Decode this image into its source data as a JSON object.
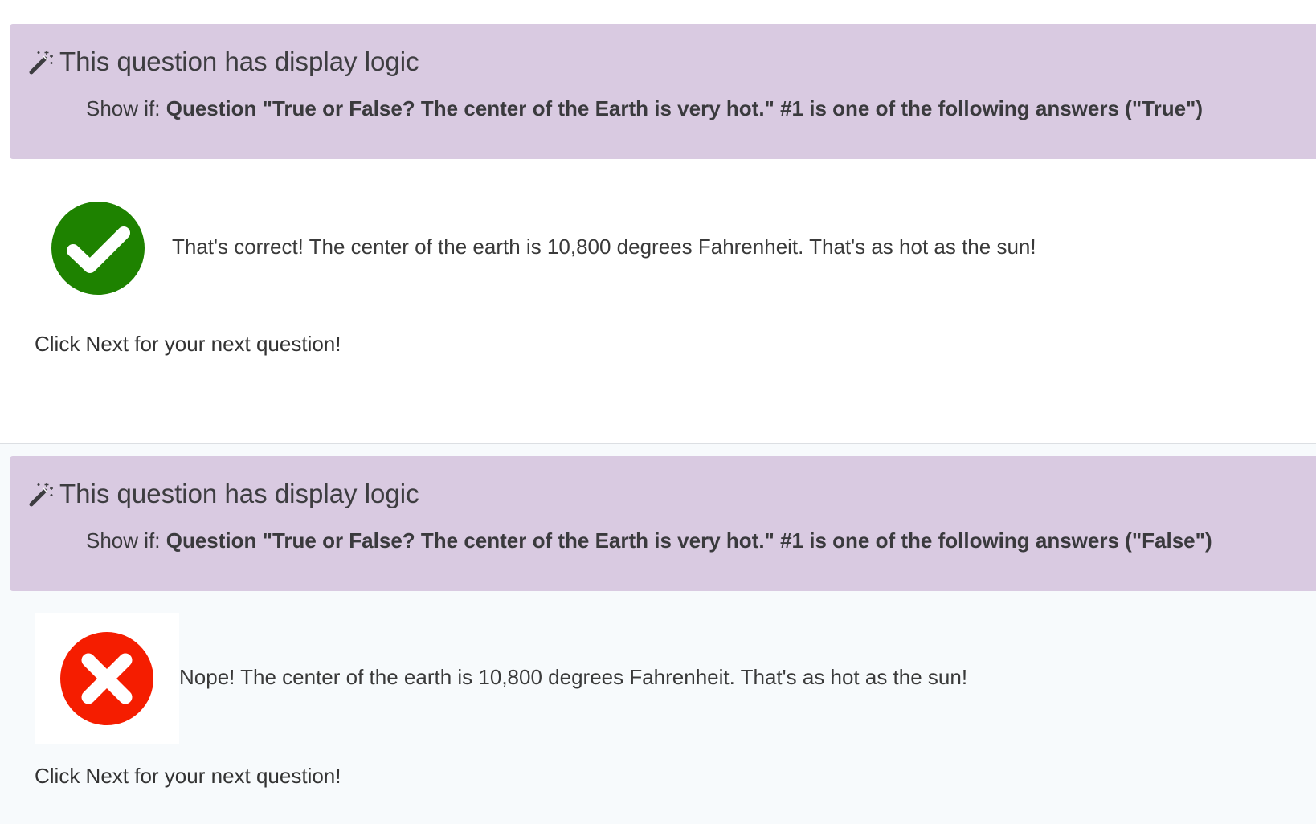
{
  "blocks": [
    {
      "logic_title": "This question has display logic",
      "logic_prefix": "Show if:",
      "logic_condition": "Question \"True or False? The center of the Earth is very hot.\" #1 is one of the following answers (\"True\")",
      "icon": "checkmark-circle-icon",
      "icon_color": "#1e8200",
      "answer_text": "That's correct! The center of the earth is 10,800 degrees Fahrenheit. That's as hot as the sun!",
      "next_text": "Click Next for your next question!"
    },
    {
      "logic_title": "This question has display logic",
      "logic_prefix": "Show if:",
      "logic_condition": "Question \"True or False? The center of the Earth is very hot.\" #1 is one of the following answers (\"False\")",
      "icon": "x-circle-icon",
      "icon_color": "#f51d00",
      "answer_text": "Nope! The center of the earth is 10,800 degrees Fahrenheit. That's as hot as the sun!",
      "next_text": "Click Next for your next question!"
    }
  ],
  "colors": {
    "banner_bg": "#d9cae1",
    "alt_block_bg": "#f7fafc"
  }
}
